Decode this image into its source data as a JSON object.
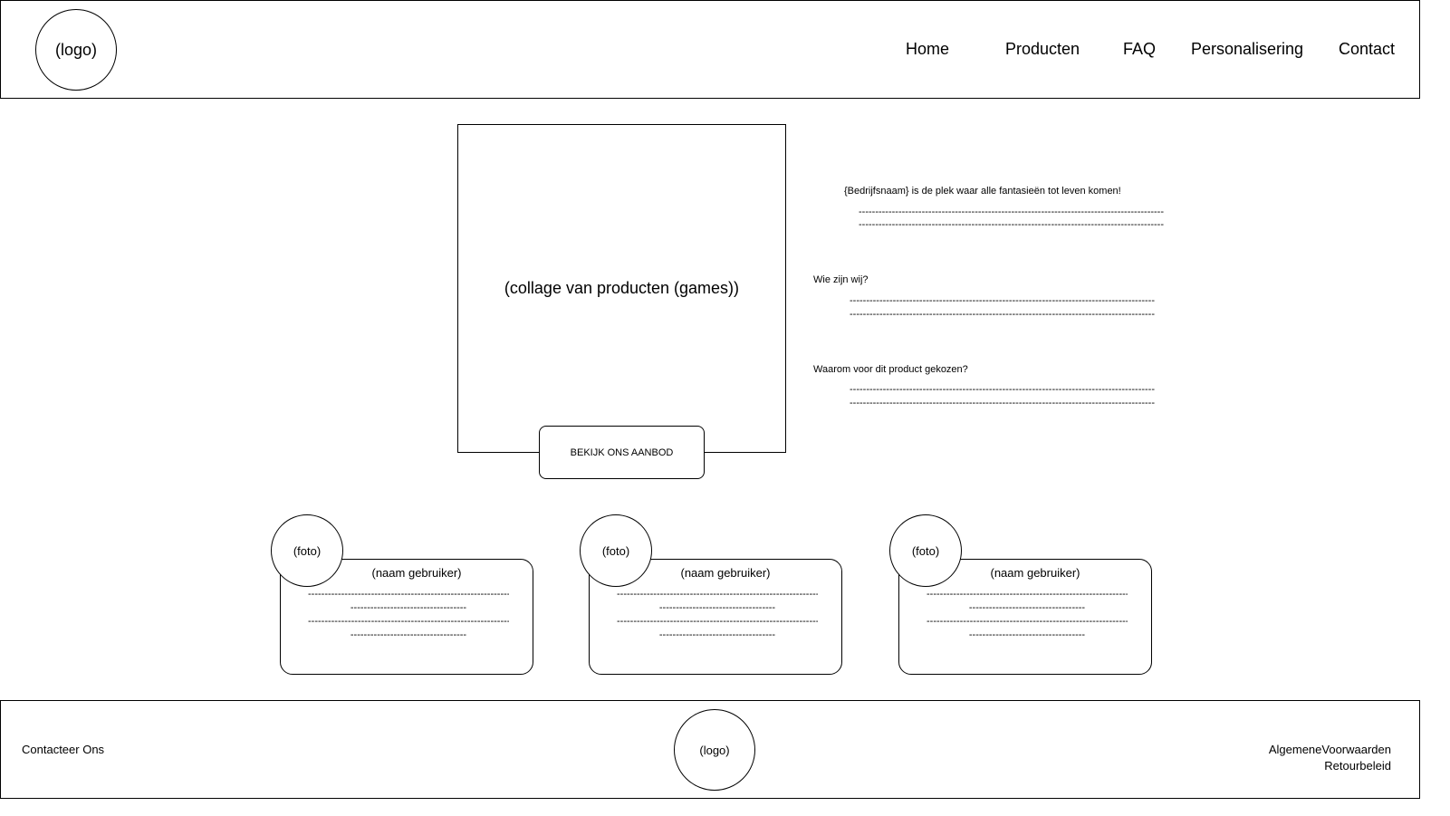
{
  "header": {
    "logo": "(logo)",
    "nav": [
      "Home",
      "Producten",
      "FAQ",
      "Personalisering",
      "Contact"
    ]
  },
  "hero": {
    "collage": "(collage van producten (games))",
    "cta": "BEKIJK ONS AANBOD"
  },
  "about": {
    "tagline": "{Bedrijfsnaam} is de plek waar alle fantasieën tot leven komen!",
    "who_title": "Wie zijn wij?",
    "why_title": "Waarom voor dit product gekozen?",
    "placeholder_line": "--------------------------------------------------------------------------------------------"
  },
  "reviews": [
    {
      "photo": "(foto)",
      "name": "(naam gebruiker)"
    },
    {
      "photo": "(foto)",
      "name": "(naam gebruiker)"
    },
    {
      "photo": "(foto)",
      "name": "(naam gebruiker)"
    }
  ],
  "review_lines": {
    "long": "-------------------------------------------------------------",
    "short": "-----------------------------------"
  },
  "footer": {
    "contact": "Contacteer Ons",
    "logo": "(logo)",
    "terms": "AlgemeneVoorwaarden",
    "returns": "Retourbeleid"
  }
}
